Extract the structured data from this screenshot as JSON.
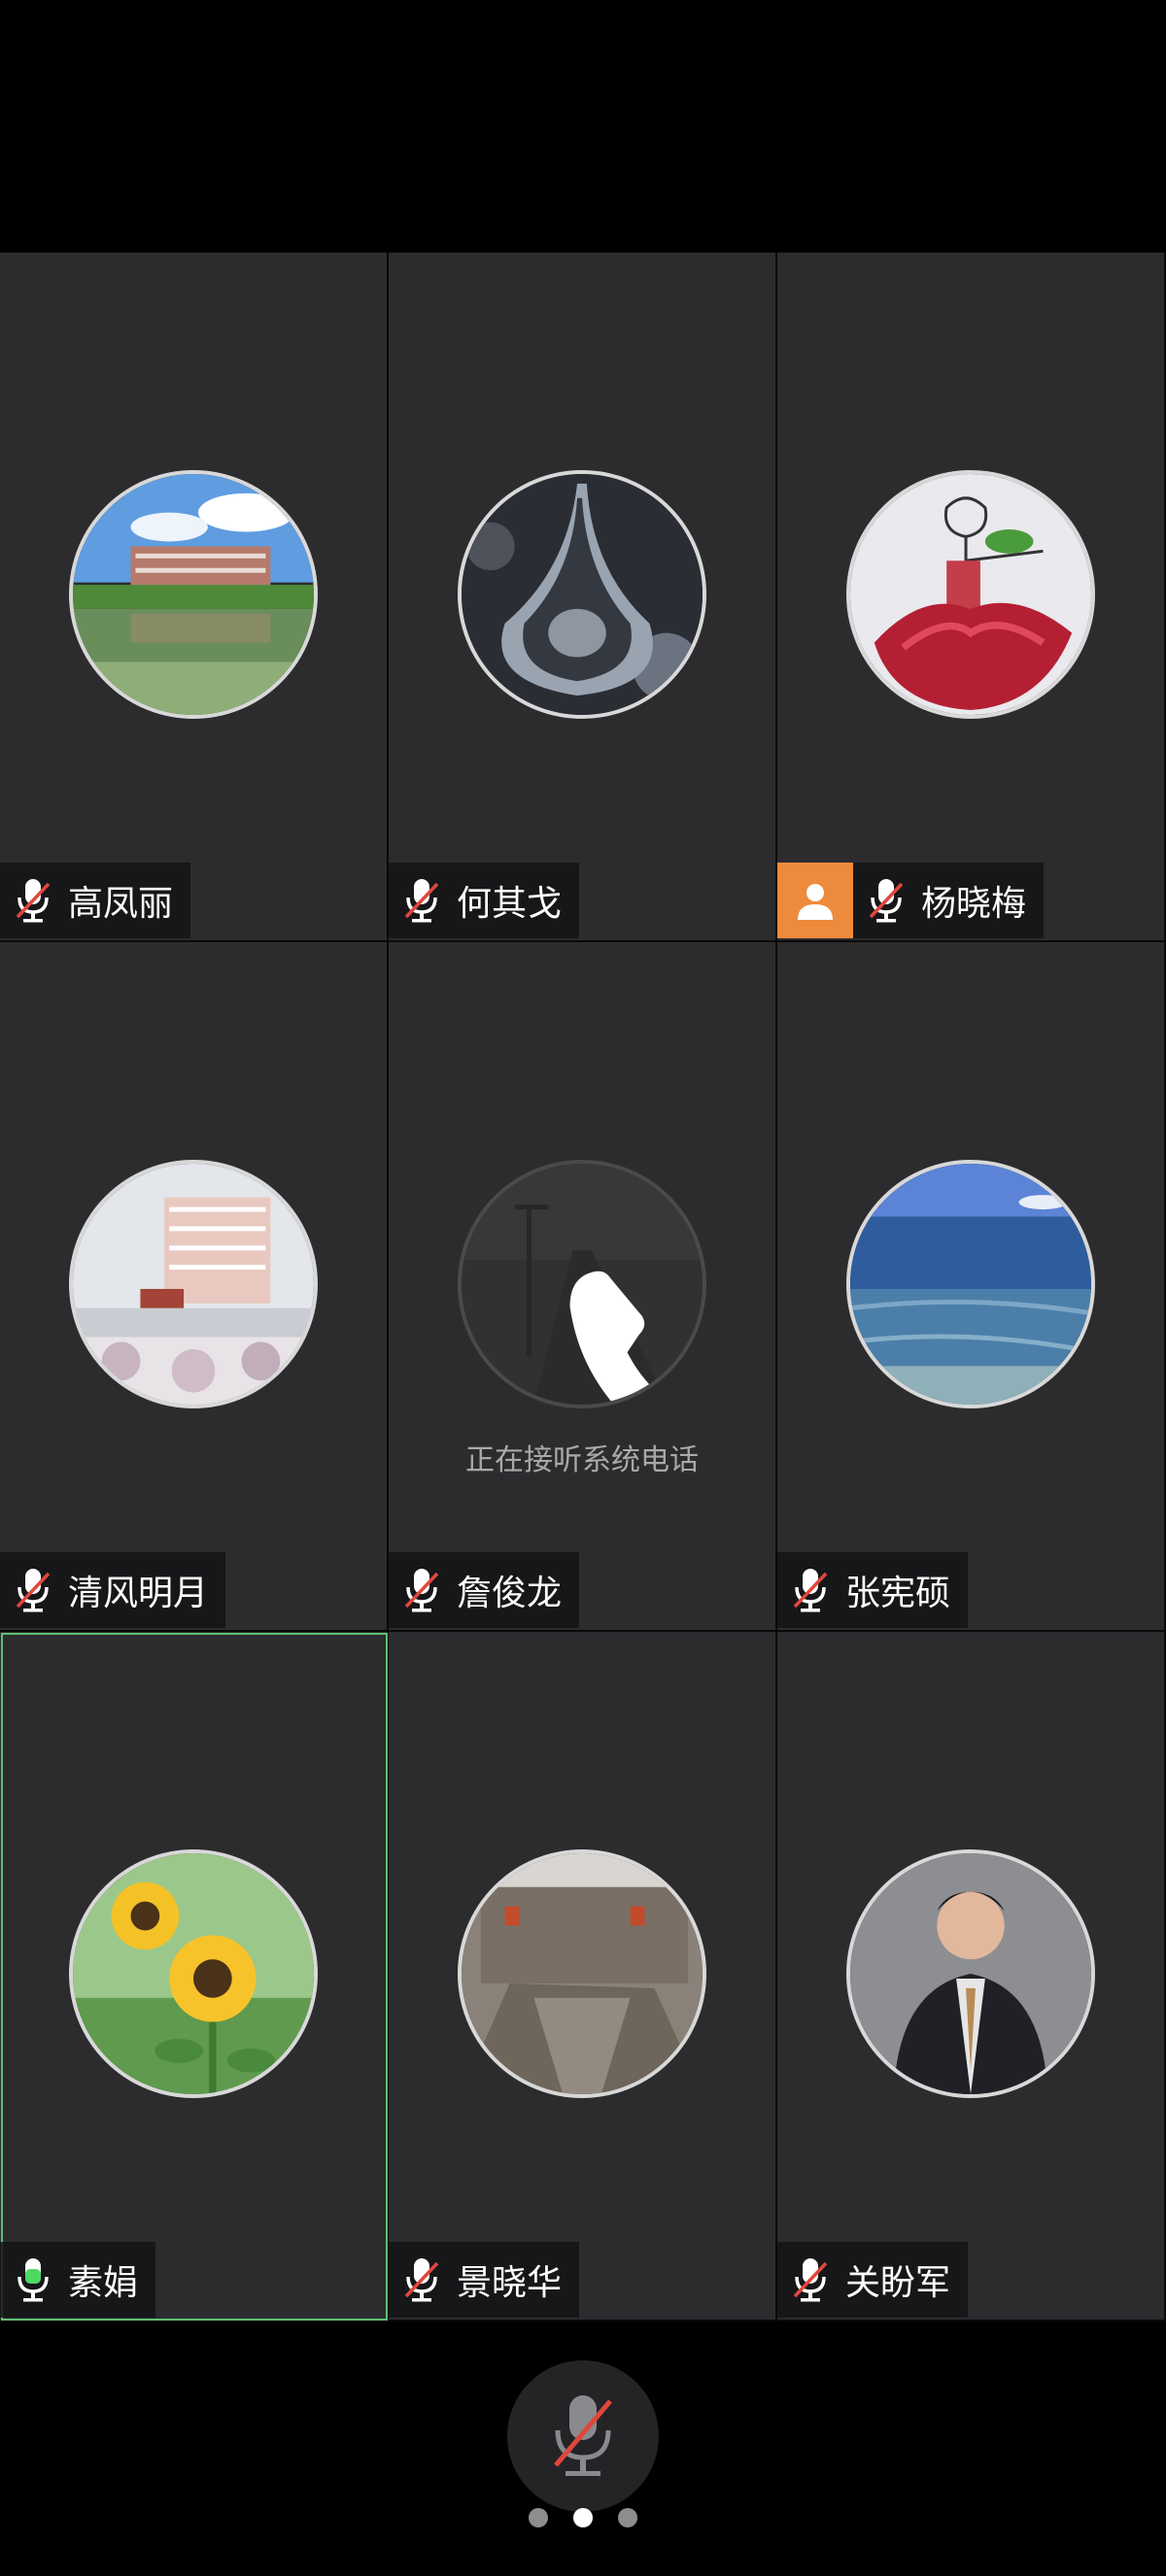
{
  "participants": [
    {
      "name": "高凤丽",
      "mic": "muted",
      "host": false,
      "status": ""
    },
    {
      "name": "何其戈",
      "mic": "muted",
      "host": false,
      "status": ""
    },
    {
      "name": "杨晓梅",
      "mic": "muted",
      "host": true,
      "status": ""
    },
    {
      "name": "清风明月",
      "mic": "muted",
      "host": false,
      "status": ""
    },
    {
      "name": "詹俊龙",
      "mic": "muted",
      "host": false,
      "status": "正在接听系统电话"
    },
    {
      "name": "张宪硕",
      "mic": "muted",
      "host": false,
      "status": ""
    },
    {
      "name": "素娟",
      "mic": "speaking",
      "host": false,
      "status": ""
    },
    {
      "name": "景晓华",
      "mic": "muted",
      "host": false,
      "status": ""
    },
    {
      "name": "关盼军",
      "mic": "muted",
      "host": false,
      "status": ""
    }
  ],
  "controls": {
    "mute_button_icon": "mic-muted-icon"
  },
  "pagination": {
    "pages": 3,
    "current": 2
  },
  "colors": {
    "tile_bg": "#2c2c2f",
    "active_border": "#5fbf73",
    "host_badge": "#ee8a3c",
    "mute_slash": "#e0473c",
    "speaking_mic": "#4cd964"
  }
}
